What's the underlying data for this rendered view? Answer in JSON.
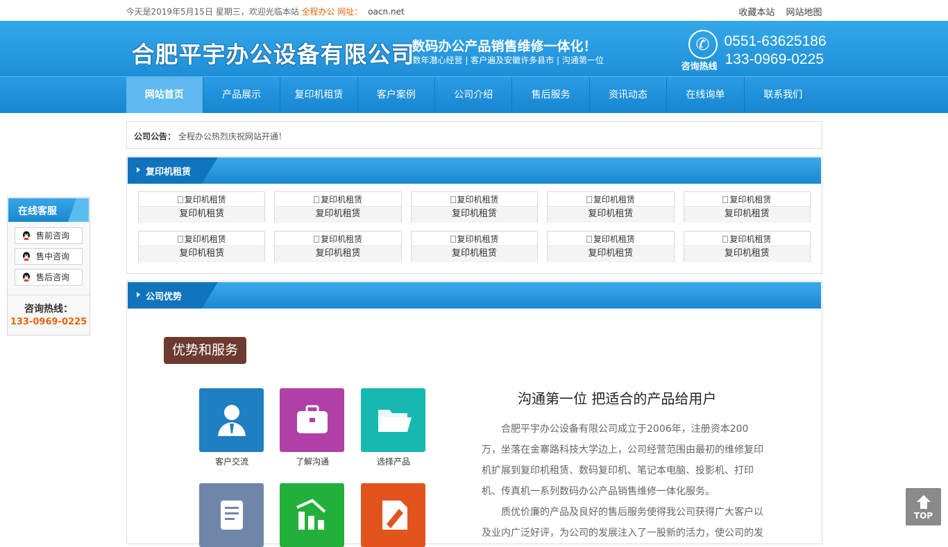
{
  "topbar": {
    "greeting": "今天是2019年5月15日 星期三，欢迎光临本站",
    "site_name": "全程办公 网址：",
    "domain": "oacn.net",
    "bookmark_label": "收藏本站",
    "sitemap_label": "网站地图"
  },
  "header": {
    "company_name": "合肥平宇办公设备有限公司",
    "slogan": "数码办公产品销售维修一体化！",
    "slogan_sub": "数年潜心经营 | 客户遍及安徽许多县市 | 沟通第一位",
    "hotline_label": "咨询热线",
    "phone_1": "0551-63625186",
    "phone_2": "133-0969-0225",
    "phone_icon": "phone-icon"
  },
  "nav": {
    "items": [
      {
        "label": "网站首页",
        "active": true
      },
      {
        "label": "产品展示"
      },
      {
        "label": "复印机租赁"
      },
      {
        "label": "客户案例"
      },
      {
        "label": "公司介绍"
      },
      {
        "label": "售后服务"
      },
      {
        "label": "资讯动态"
      },
      {
        "label": "在线询单"
      },
      {
        "label": "联系我们"
      }
    ]
  },
  "notice": {
    "label": "公司公告：",
    "text": "全程办公热烈庆祝网站开通！"
  },
  "rental": {
    "title": "复印机租赁",
    "rows": [
      [
        {
          "alt": "复印机租赁",
          "caption": "复印机租赁"
        },
        {
          "alt": "复印机租赁",
          "caption": "复印机租赁"
        },
        {
          "alt": "复印机租赁",
          "caption": "复印机租赁"
        },
        {
          "alt": "复印机租赁",
          "caption": "复印机租赁"
        },
        {
          "alt": "复印机租赁",
          "caption": "复印机租赁"
        }
      ],
      [
        {
          "alt": "复印机租赁",
          "caption": "复印机租赁"
        },
        {
          "alt": "复印机租赁",
          "caption": "复印机租赁"
        },
        {
          "alt": "复印机租赁",
          "caption": "复印机租赁"
        },
        {
          "alt": "复印机租赁",
          "caption": "复印机租赁"
        },
        {
          "alt": "复印机租赁",
          "caption": "复印机租赁"
        }
      ]
    ]
  },
  "advantages": {
    "title": "公司优势",
    "badge": "优势和服务",
    "tiles": [
      {
        "label": "客户交流",
        "color": "#1f7fc3",
        "icon": "user-icon"
      },
      {
        "label": "了解沟通",
        "color": "#b13fa8",
        "icon": "briefcase-icon"
      },
      {
        "label": "选择产品",
        "color": "#16b8b0",
        "icon": "folder-icon"
      },
      {
        "label": "",
        "color": "#6f86a8",
        "icon": "document-icon"
      },
      {
        "label": "",
        "color": "#23b03a",
        "icon": "chart-icon"
      },
      {
        "label": "",
        "color": "#e1541e",
        "icon": "edit-icon"
      }
    ],
    "heading": "沟通第一位 把适合的产品给用户",
    "paragraph_1": "合肥平宇办公设备有限公司成立于2006年，注册资本200万，坐落在金寨路科技大学边上，公司经营范围由最初的维修复印机扩展到复印机租赁、数码复印机、笔记本电脑、投影机、打印机、传真机一系列数码办公产品销售维修一体化服务。",
    "paragraph_2": "质优价廉的产品及良好的售后服务使得我公司获得广大客户以及业内广泛好评，为公司的发展注入了一股新的活力，使公司的发"
  },
  "sidebar": {
    "title": "在线客服",
    "buttons": [
      "售前咨询",
      "售中咨询",
      "售后咨询"
    ],
    "hotline_label": "咨询热线：",
    "hotline_number": "133-0969-0225"
  },
  "back_to_top": {
    "label": "TOP"
  }
}
